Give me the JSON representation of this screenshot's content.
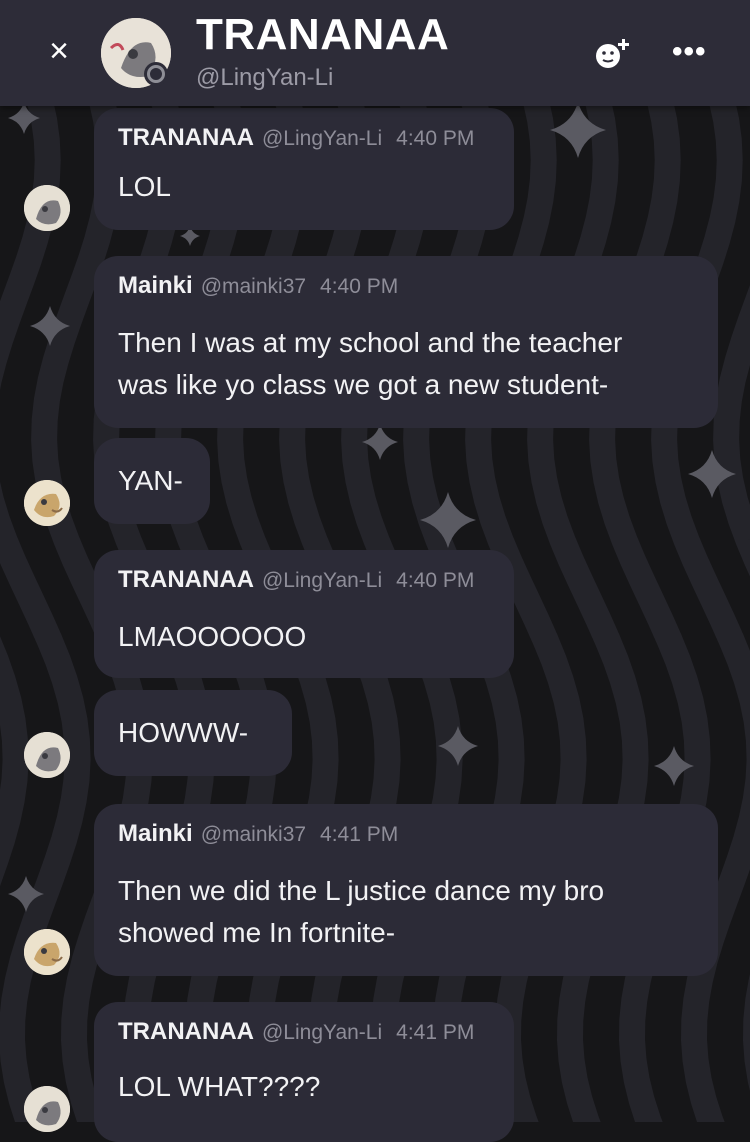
{
  "header": {
    "title": "TRANANAA",
    "handle": "@LingYan-Li",
    "close_label": "×",
    "more_label": "•••"
  },
  "messages": [
    {
      "name": "TRANANAA",
      "handle": "@LingYan-Li",
      "time": "4:40 PM",
      "text": "LOL"
    },
    {
      "name": "Mainki",
      "handle": "@mainki37",
      "time": "4:40 PM",
      "text": "Then I was at my school and the teacher\nwas like yo class we got a new student-"
    },
    {
      "text": "YAN-"
    },
    {
      "name": "TRANANAA",
      "handle": "@LingYan-Li",
      "time": "4:40 PM",
      "text": "LMAOOOOOO"
    },
    {
      "text": "HOWWW-"
    },
    {
      "name": "Mainki",
      "handle": "@mainki37",
      "time": "4:41 PM",
      "text": "Then we did the L justice dance my bro\nshowed me In fortnite-"
    },
    {
      "name": "TRANANAA",
      "handle": "@LingYan-Li",
      "time": "4:41 PM",
      "text": "LOL WHAT????"
    }
  ],
  "colors": {
    "header_bg": "#2d2c38",
    "bubble_bg": "#2c2b37",
    "background": "#161618",
    "muted_text": "#8e8d98"
  },
  "icons": [
    "close-icon",
    "avatar",
    "add-reaction-icon",
    "more-options-icon",
    "sparkle-star-icon"
  ]
}
